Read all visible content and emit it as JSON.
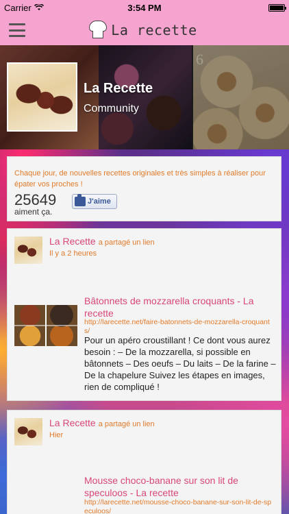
{
  "status_bar": {
    "carrier": "Carrier",
    "time": "3:54 PM"
  },
  "nav": {
    "app_title": "La recette",
    "icons": {
      "menu": "menu-icon",
      "logo": "chef-hat-icon"
    }
  },
  "header": {
    "title": "La Recette",
    "subtitle": "Community",
    "tile_number": "6"
  },
  "about": {
    "description": "Chaque jour, de nouvelles recettes originales et très simples à réaliser pour épater vos proches !",
    "like_count": "25649",
    "like_count_label": "aiment ça.",
    "like_button_label": "J'aime"
  },
  "posts": [
    {
      "author": "La Recette",
      "action": "a partagé un lien",
      "time": "Il y a 2 heures",
      "link_title": "Bâtonnets de mozzarella croquants - La recette",
      "url": "http://larecette.net/faire-batonnets-de-mozzarella-croquants/",
      "description": "Pour un apéro croustillant ! Ce dont vous aurez besoin : – De la mozzarella, si possible en bâtonnets – Des oeufs – Du laits – De la farine – De la chapelure Suivez les étapes en images, rien de compliqué !"
    },
    {
      "author": "La Recette",
      "action": "a partagé un lien",
      "time": "Hier",
      "link_title": "Mousse choco-banane sur son lit de speculoos - La recette",
      "url": "http://larecette.net/mousse-choco-banane-sur-son-lit-de-speculoos/"
    }
  ],
  "colors": {
    "nav": "#f5a3cf",
    "accent_pink": "#d9467a",
    "accent_orange": "#e07a2a",
    "facebook": "#3b5998"
  }
}
